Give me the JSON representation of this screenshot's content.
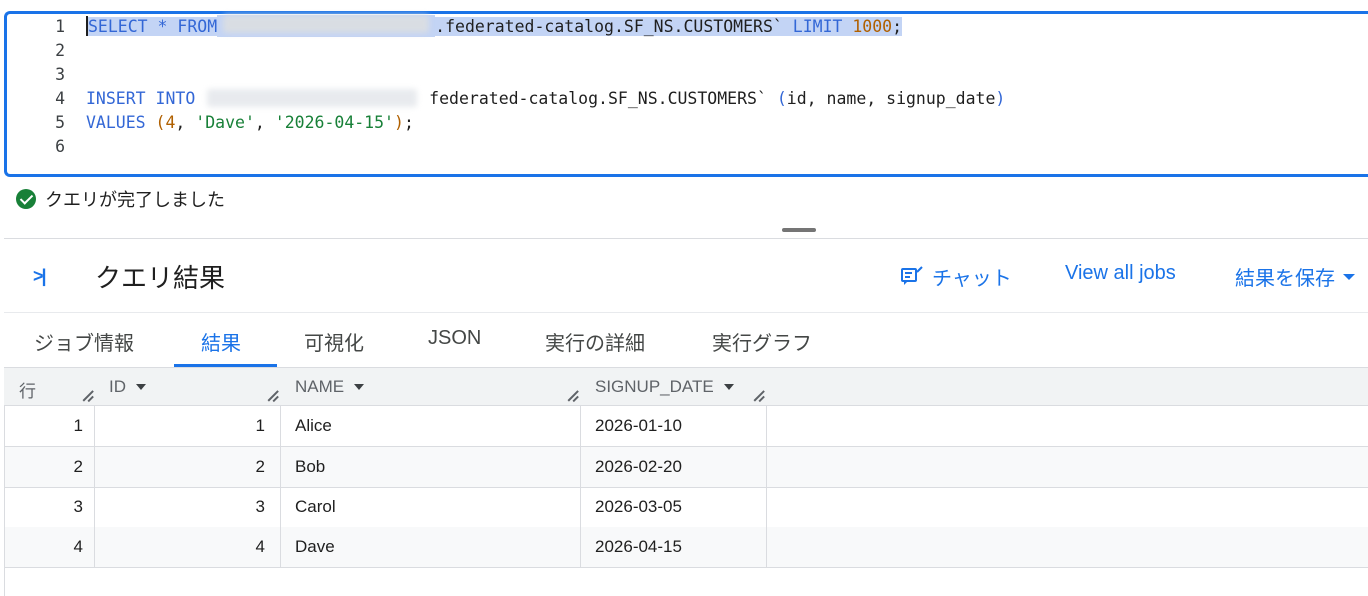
{
  "editor": {
    "lines": [
      {
        "n": "1",
        "select_kw": "SELECT * FROM",
        "table": ".federated-catalog.SF_NS.CUSTOMERS`",
        "limit_kw": "LIMIT",
        "limit_val": "1000",
        "end": ";"
      },
      {
        "n": "2"
      },
      {
        "n": "3"
      },
      {
        "n": "4",
        "insert_kw": "INSERT INTO",
        "table": "federated-catalog.SF_NS.CUSTOMERS`",
        "paren_open": "(",
        "cols": "id, name, signup_date",
        "paren_close": ")"
      },
      {
        "n": "5",
        "values_kw": "VALUES",
        "paren_open": "(",
        "num": "4",
        "sep1": ", ",
        "str1": "'Dave'",
        "sep2": ", ",
        "str2": "'2026-04-15'",
        "paren_close": ")",
        "end": ";"
      },
      {
        "n": "6"
      }
    ]
  },
  "status": {
    "text": "クエリが完了しました"
  },
  "results": {
    "title": "クエリ結果",
    "chat_label": "チャット",
    "view_jobs_label": "View all jobs",
    "save_label": "結果を保存"
  },
  "tabs": [
    "ジョブ情報",
    "結果",
    "可視化",
    "JSON",
    "実行の詳細",
    "実行グラフ"
  ],
  "active_tab": "結果",
  "table": {
    "headers": {
      "row": "行",
      "id": "ID",
      "name": "NAME",
      "signup_date": "SIGNUP_DATE"
    },
    "rows": [
      {
        "row": "1",
        "id": "1",
        "name": "Alice",
        "signup_date": "2026-01-10"
      },
      {
        "row": "2",
        "id": "2",
        "name": "Bob",
        "signup_date": "2026-02-20"
      },
      {
        "row": "3",
        "id": "3",
        "name": "Carol",
        "signup_date": "2026-03-05"
      },
      {
        "row": "4",
        "id": "4",
        "name": "Dave",
        "signup_date": "2026-04-15"
      }
    ]
  },
  "colors": {
    "accent": "#1a73e8",
    "success": "#188038",
    "keyword": "#3367d6",
    "number": "#b06000",
    "string": "#188038"
  }
}
